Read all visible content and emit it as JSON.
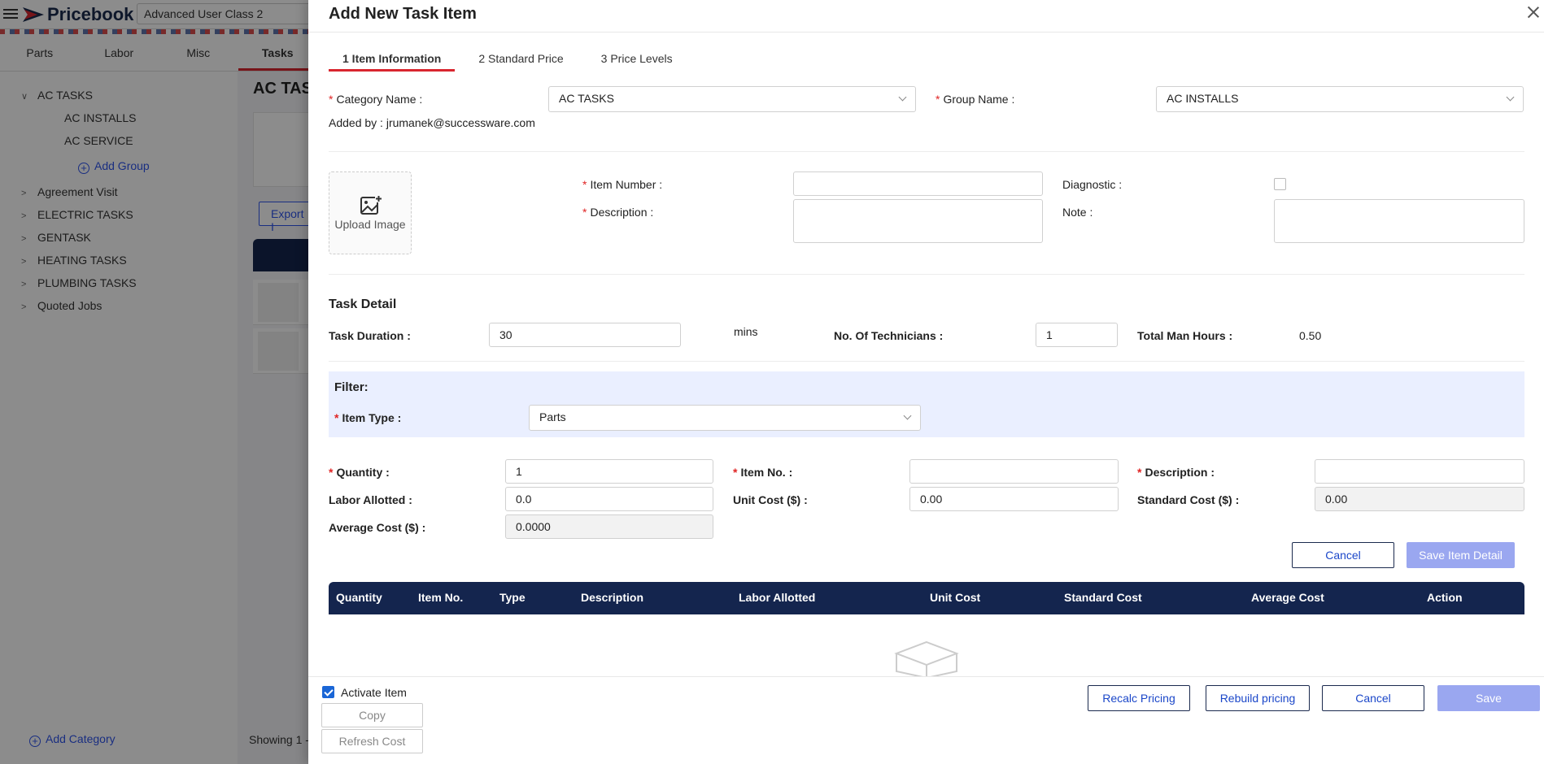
{
  "app": {
    "logo_text": "Pricebook",
    "search_value": "Advanced User Class 2",
    "nav_tabs": [
      "Parts",
      "Labor",
      "Misc",
      "Tasks"
    ],
    "active_tab": "Tasks",
    "tree": {
      "ac_tasks": "AC TASKS",
      "ac_installs": "AC INSTALLS",
      "ac_service": "AC SERVICE",
      "add_group": "Add Group",
      "agreement_visit": "Agreement Visit",
      "electric_tasks": "ELECTRIC TASKS",
      "gentask": "GENTASK",
      "heating_tasks": "HEATING TASKS",
      "plumbing_tasks": "PLUMBING TASKS",
      "quoted_jobs": "Quoted Jobs"
    },
    "add_category": "Add Category",
    "main_title": "AC TAS",
    "export_label": "Export I",
    "showing_text": "Showing 1 -"
  },
  "drawer": {
    "title": "Add New Task Item",
    "steps": [
      "1 Item Information",
      "2 Standard Price",
      "3 Price Levels"
    ],
    "category_label": "Category Name :",
    "category_value": "AC TASKS",
    "group_label": "Group Name :",
    "group_value": "AC INSTALLS",
    "added_by": "Added by : jrumanek@successware.com",
    "upload_label": "Upload Image",
    "item_number_label": "Item Number :",
    "item_number_value": "",
    "description_label": "Description :",
    "description_value": "",
    "diagnostic_label": "Diagnostic :",
    "diagnostic_checked": false,
    "note_label": "Note :",
    "note_value": "",
    "task_detail_heading": "Task Detail",
    "task_duration_label": "Task Duration :",
    "task_duration_value": "30",
    "mins_label": "mins",
    "technicians_label": "No. Of Technicians :",
    "technicians_value": "1",
    "total_man_hours_label": "Total Man Hours :",
    "total_man_hours_value": "0.50",
    "filter_heading": "Filter:",
    "item_type_label": "Item Type :",
    "item_type_value": "Parts",
    "quantity_label": "Quantity :",
    "quantity_value": "1",
    "item_no_label": "Item No. :",
    "item_no_value": "",
    "line_description_label": "Description :",
    "line_description_value": "",
    "labor_allotted_label": "Labor Allotted :",
    "labor_allotted_value": "0.0",
    "unit_cost_label": "Unit Cost ($) :",
    "unit_cost_value": "0.00",
    "standard_cost_label": "Standard Cost ($) :",
    "standard_cost_value": "0.00",
    "average_cost_label": "Average Cost ($) :",
    "average_cost_value": "0.0000",
    "cancel_detail_label": "Cancel",
    "save_item_detail_label": "Save Item Detail",
    "table_columns": [
      "Quantity",
      "Item No.",
      "Type",
      "Description",
      "Labor Allotted",
      "Unit Cost",
      "Standard Cost",
      "Average Cost",
      "Action"
    ],
    "footer": {
      "activate_label": "Activate Item",
      "activate_checked": true,
      "copy_label": "Copy",
      "refresh_cost_label": "Refresh Cost",
      "recalc_label": "Recalc Pricing",
      "rebuild_label": "Rebuild pricing",
      "cancel_label": "Cancel",
      "save_label": "Save"
    }
  },
  "colors": {
    "navy": "#14254e",
    "accent_red": "#d9262f",
    "link_blue": "#2f54eb",
    "disabled_primary": "#9aa7f0",
    "filter_bg": "#eaefff"
  }
}
